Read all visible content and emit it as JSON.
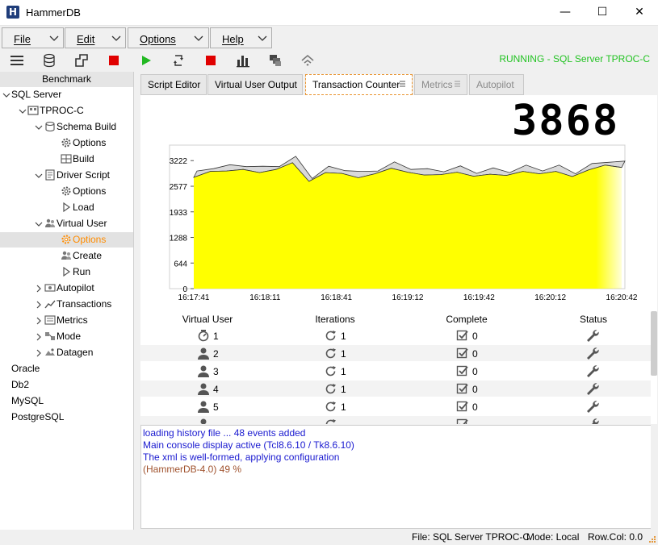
{
  "window": {
    "title": "HammerDB",
    "minimize_glyph": "—",
    "maximize_glyph": "☐",
    "close_glyph": "✕"
  },
  "menu": [
    {
      "label": "File"
    },
    {
      "label": "Edit"
    },
    {
      "label": "Options"
    },
    {
      "label": "Help"
    }
  ],
  "toolbar": {
    "status": "RUNNING - SQL Server TPROC-C",
    "icons": [
      "hamburger-icon",
      "database-icon",
      "build-icon",
      "stop-icon",
      "play-icon",
      "reload-icon",
      "stop-icon",
      "bar-chart-icon",
      "stack-icon",
      "antenna-icon"
    ]
  },
  "tree": {
    "header": "Benchmark",
    "nodes": [
      {
        "label": "SQL Server",
        "level": 0,
        "expanded": true
      },
      {
        "label": "TPROC-C",
        "level": 1,
        "expanded": true
      },
      {
        "label": "Schema Build",
        "level": 2,
        "expanded": true
      },
      {
        "label": "Options",
        "level": 3
      },
      {
        "label": "Build",
        "level": 3
      },
      {
        "label": "Driver Script",
        "level": 2,
        "expanded": true
      },
      {
        "label": "Options",
        "level": 3
      },
      {
        "label": "Load",
        "level": 3
      },
      {
        "label": "Virtual User",
        "level": 2,
        "expanded": true
      },
      {
        "label": "Options",
        "level": 3,
        "selected": true
      },
      {
        "label": "Create",
        "level": 3
      },
      {
        "label": "Run",
        "level": 3
      },
      {
        "label": "Autopilot",
        "level": 2
      },
      {
        "label": "Transactions",
        "level": 2
      },
      {
        "label": "Metrics",
        "level": 2
      },
      {
        "label": "Mode",
        "level": 2
      },
      {
        "label": "Datagen",
        "level": 2
      },
      {
        "label": "Oracle",
        "level": 0
      },
      {
        "label": "Db2",
        "level": 0
      },
      {
        "label": "MySQL",
        "level": 0
      },
      {
        "label": "PostgreSQL",
        "level": 0
      }
    ]
  },
  "tabs": [
    {
      "label": "Script Editor"
    },
    {
      "label": "Virtual User Output"
    },
    {
      "label": "Transaction Counter",
      "active": true
    },
    {
      "label": "Metrics",
      "disabled": true
    },
    {
      "label": "Autopilot",
      "disabled": true
    }
  ],
  "tpm": "3868 tpm",
  "chart_data": {
    "type": "area",
    "x": [
      "16:17:41",
      "16:18:11",
      "16:18:41",
      "16:19:12",
      "16:19:42",
      "16:20:12",
      "16:20:42"
    ],
    "yticks": [
      0,
      644,
      1288,
      1933,
      2577,
      3222
    ],
    "ylim": [
      0,
      3450
    ],
    "values": [
      2800,
      2950,
      2960,
      3000,
      2920,
      3000,
      3170,
      2700,
      2920,
      2900,
      2790,
      2890,
      3030,
      2930,
      2860,
      2870,
      2930,
      2830,
      2880,
      2850,
      2950,
      2890,
      2950,
      2820,
      2990,
      3110,
      3050
    ],
    "fill": "#ffff00"
  },
  "grid": {
    "headers": [
      "Virtual User",
      "Iterations",
      "Complete",
      "Status"
    ],
    "rows": [
      {
        "vu": "1",
        "iterations": "1",
        "complete": "0"
      },
      {
        "vu": "2",
        "iterations": "1",
        "complete": "0"
      },
      {
        "vu": "3",
        "iterations": "1",
        "complete": "0"
      },
      {
        "vu": "4",
        "iterations": "1",
        "complete": "0"
      },
      {
        "vu": "5",
        "iterations": "1",
        "complete": "0"
      }
    ]
  },
  "console": [
    {
      "text": "loading history file ... 48 events added",
      "color": "blue"
    },
    {
      "text": "Main console display active (Tcl8.6.10 / Tk8.6.10)",
      "color": "blue"
    },
    {
      "text": "The xml is well-formed, applying configuration",
      "color": "blue"
    },
    {
      "text": "(HammerDB-4.0) 49 %",
      "color": "brown"
    }
  ],
  "statusbar": {
    "file": "File: SQL Server TPROC-C",
    "mode": "Mode: Local",
    "rowcol": "Row.Col:  0.0"
  }
}
